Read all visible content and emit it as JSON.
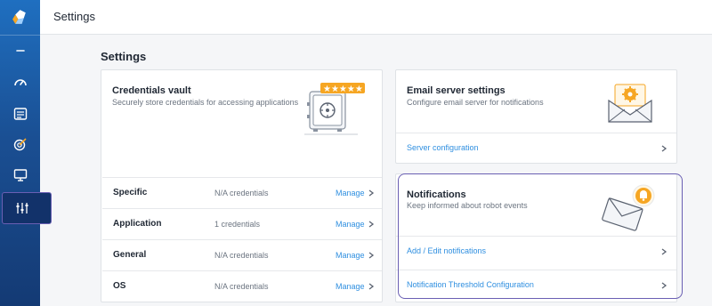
{
  "app": {
    "logo_icon": "app-logo-icon",
    "window_title": "Settings"
  },
  "colors": {
    "sidebar": "#1a4f93",
    "link": "#2f8fe0",
    "highlight": "#6a5fb3"
  },
  "sidebar": {
    "items": [
      {
        "name": "collapse",
        "icon": "minus-icon"
      },
      {
        "name": "dashboard",
        "icon": "gauge-icon"
      },
      {
        "name": "list",
        "icon": "list-icon"
      },
      {
        "name": "targets",
        "icon": "target-icon"
      },
      {
        "name": "monitor",
        "icon": "monitor-icon"
      },
      {
        "name": "settings",
        "icon": "sliders-icon",
        "active": true
      }
    ]
  },
  "page": {
    "title": "Settings"
  },
  "credentials_vault": {
    "title": "Credentials vault",
    "description": "Securely store credentials for accessing applications",
    "rows": [
      {
        "label": "Specific",
        "count": "N/A credentials",
        "action": "Manage"
      },
      {
        "label": "Application",
        "count": "1 credentials",
        "action": "Manage"
      },
      {
        "label": "General",
        "count": "N/A credentials",
        "action": "Manage"
      },
      {
        "label": "OS",
        "count": "N/A credentials",
        "action": "Manage"
      }
    ]
  },
  "email_server": {
    "title": "Email server settings",
    "description": "Configure email server for notifications",
    "link": "Server configuration"
  },
  "notifications": {
    "title": "Notifications",
    "description": "Keep informed about robot events",
    "links": [
      "Add / Edit notifications",
      "Notification Threshold Configuration"
    ]
  }
}
